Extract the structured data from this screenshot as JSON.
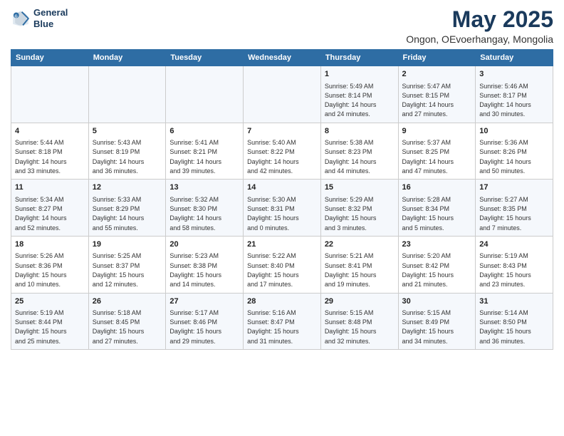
{
  "logo": {
    "line1": "General",
    "line2": "Blue"
  },
  "title": "May 2025",
  "subtitle": "Ongon, OEvoerhangay, Mongolia",
  "weekdays": [
    "Sunday",
    "Monday",
    "Tuesday",
    "Wednesday",
    "Thursday",
    "Friday",
    "Saturday"
  ],
  "weeks": [
    [
      {
        "day": "",
        "detail": ""
      },
      {
        "day": "",
        "detail": ""
      },
      {
        "day": "",
        "detail": ""
      },
      {
        "day": "",
        "detail": ""
      },
      {
        "day": "1",
        "detail": "Sunrise: 5:49 AM\nSunset: 8:14 PM\nDaylight: 14 hours\nand 24 minutes."
      },
      {
        "day": "2",
        "detail": "Sunrise: 5:47 AM\nSunset: 8:15 PM\nDaylight: 14 hours\nand 27 minutes."
      },
      {
        "day": "3",
        "detail": "Sunrise: 5:46 AM\nSunset: 8:17 PM\nDaylight: 14 hours\nand 30 minutes."
      }
    ],
    [
      {
        "day": "4",
        "detail": "Sunrise: 5:44 AM\nSunset: 8:18 PM\nDaylight: 14 hours\nand 33 minutes."
      },
      {
        "day": "5",
        "detail": "Sunrise: 5:43 AM\nSunset: 8:19 PM\nDaylight: 14 hours\nand 36 minutes."
      },
      {
        "day": "6",
        "detail": "Sunrise: 5:41 AM\nSunset: 8:21 PM\nDaylight: 14 hours\nand 39 minutes."
      },
      {
        "day": "7",
        "detail": "Sunrise: 5:40 AM\nSunset: 8:22 PM\nDaylight: 14 hours\nand 42 minutes."
      },
      {
        "day": "8",
        "detail": "Sunrise: 5:38 AM\nSunset: 8:23 PM\nDaylight: 14 hours\nand 44 minutes."
      },
      {
        "day": "9",
        "detail": "Sunrise: 5:37 AM\nSunset: 8:25 PM\nDaylight: 14 hours\nand 47 minutes."
      },
      {
        "day": "10",
        "detail": "Sunrise: 5:36 AM\nSunset: 8:26 PM\nDaylight: 14 hours\nand 50 minutes."
      }
    ],
    [
      {
        "day": "11",
        "detail": "Sunrise: 5:34 AM\nSunset: 8:27 PM\nDaylight: 14 hours\nand 52 minutes."
      },
      {
        "day": "12",
        "detail": "Sunrise: 5:33 AM\nSunset: 8:29 PM\nDaylight: 14 hours\nand 55 minutes."
      },
      {
        "day": "13",
        "detail": "Sunrise: 5:32 AM\nSunset: 8:30 PM\nDaylight: 14 hours\nand 58 minutes."
      },
      {
        "day": "14",
        "detail": "Sunrise: 5:30 AM\nSunset: 8:31 PM\nDaylight: 15 hours\nand 0 minutes."
      },
      {
        "day": "15",
        "detail": "Sunrise: 5:29 AM\nSunset: 8:32 PM\nDaylight: 15 hours\nand 3 minutes."
      },
      {
        "day": "16",
        "detail": "Sunrise: 5:28 AM\nSunset: 8:34 PM\nDaylight: 15 hours\nand 5 minutes."
      },
      {
        "day": "17",
        "detail": "Sunrise: 5:27 AM\nSunset: 8:35 PM\nDaylight: 15 hours\nand 7 minutes."
      }
    ],
    [
      {
        "day": "18",
        "detail": "Sunrise: 5:26 AM\nSunset: 8:36 PM\nDaylight: 15 hours\nand 10 minutes."
      },
      {
        "day": "19",
        "detail": "Sunrise: 5:25 AM\nSunset: 8:37 PM\nDaylight: 15 hours\nand 12 minutes."
      },
      {
        "day": "20",
        "detail": "Sunrise: 5:23 AM\nSunset: 8:38 PM\nDaylight: 15 hours\nand 14 minutes."
      },
      {
        "day": "21",
        "detail": "Sunrise: 5:22 AM\nSunset: 8:40 PM\nDaylight: 15 hours\nand 17 minutes."
      },
      {
        "day": "22",
        "detail": "Sunrise: 5:21 AM\nSunset: 8:41 PM\nDaylight: 15 hours\nand 19 minutes."
      },
      {
        "day": "23",
        "detail": "Sunrise: 5:20 AM\nSunset: 8:42 PM\nDaylight: 15 hours\nand 21 minutes."
      },
      {
        "day": "24",
        "detail": "Sunrise: 5:19 AM\nSunset: 8:43 PM\nDaylight: 15 hours\nand 23 minutes."
      }
    ],
    [
      {
        "day": "25",
        "detail": "Sunrise: 5:19 AM\nSunset: 8:44 PM\nDaylight: 15 hours\nand 25 minutes."
      },
      {
        "day": "26",
        "detail": "Sunrise: 5:18 AM\nSunset: 8:45 PM\nDaylight: 15 hours\nand 27 minutes."
      },
      {
        "day": "27",
        "detail": "Sunrise: 5:17 AM\nSunset: 8:46 PM\nDaylight: 15 hours\nand 29 minutes."
      },
      {
        "day": "28",
        "detail": "Sunrise: 5:16 AM\nSunset: 8:47 PM\nDaylight: 15 hours\nand 31 minutes."
      },
      {
        "day": "29",
        "detail": "Sunrise: 5:15 AM\nSunset: 8:48 PM\nDaylight: 15 hours\nand 32 minutes."
      },
      {
        "day": "30",
        "detail": "Sunrise: 5:15 AM\nSunset: 8:49 PM\nDaylight: 15 hours\nand 34 minutes."
      },
      {
        "day": "31",
        "detail": "Sunrise: 5:14 AM\nSunset: 8:50 PM\nDaylight: 15 hours\nand 36 minutes."
      }
    ]
  ]
}
